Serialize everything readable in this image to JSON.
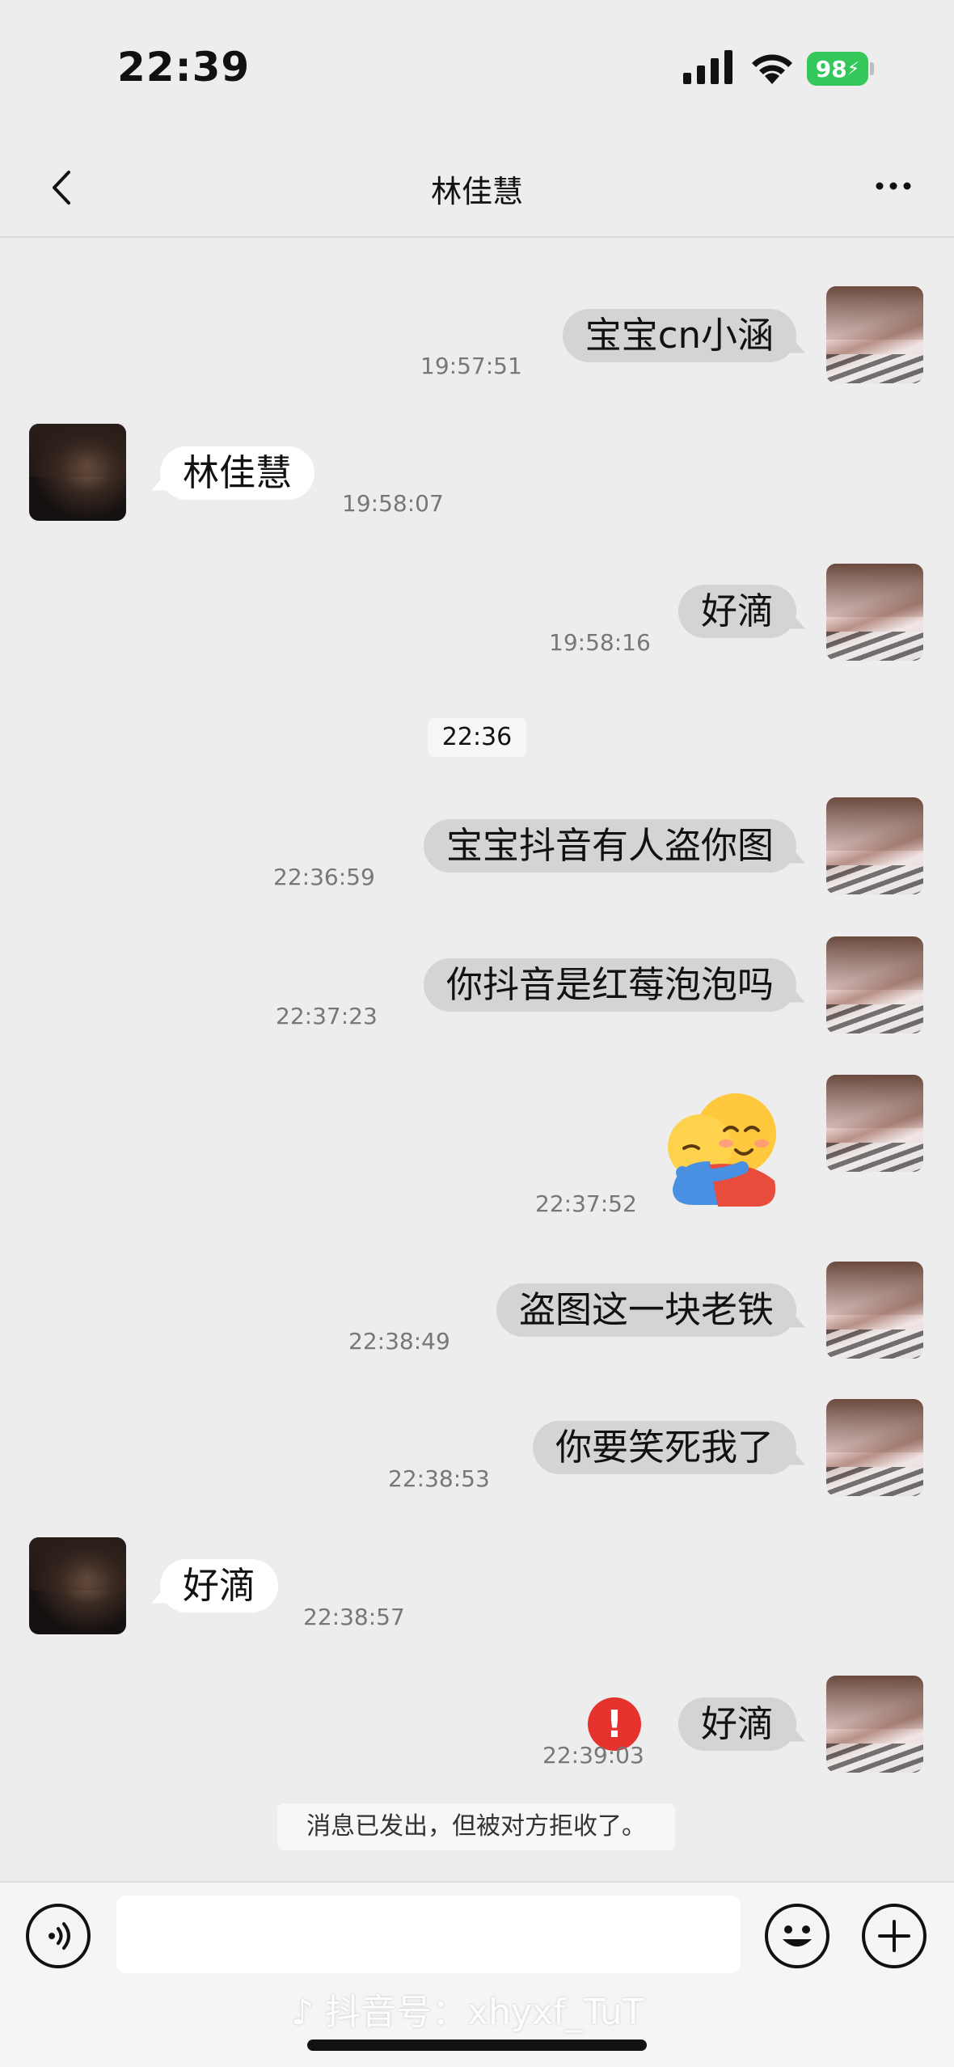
{
  "status_bar": {
    "time": "22:39",
    "battery": "98"
  },
  "nav": {
    "title": "林佳慧"
  },
  "messages": [
    {
      "side": "mine",
      "text": "宝宝cn小涵",
      "time": "19:57:51"
    },
    {
      "side": "theirs",
      "text": "林佳慧",
      "time": "19:58:07"
    },
    {
      "side": "mine",
      "text": "好滴",
      "time": "19:58:16"
    },
    {
      "side": "mine",
      "text": "宝宝抖音有人盗你图",
      "time": "22:36:59"
    },
    {
      "side": "mine",
      "text": "你抖音是红莓泡泡吗",
      "time": "22:37:23"
    },
    {
      "side": "mine",
      "sticker": "hugging-face",
      "time": "22:37:52"
    },
    {
      "side": "mine",
      "text": "盗图这一块老铁",
      "time": "22:38:49"
    },
    {
      "side": "mine",
      "text": "你要笑死我了",
      "time": "22:38:53"
    },
    {
      "side": "theirs",
      "text": "好滴",
      "time": "22:38:57"
    },
    {
      "side": "mine",
      "text": "好滴",
      "time": "22:39:03",
      "status": "rejected"
    }
  ],
  "center_time": "22:36",
  "error_icon": "!",
  "notice": "消息已发出，但被对方拒收了。",
  "input": {
    "placeholder": ""
  },
  "watermark": "抖音号：xhyxf_TuT",
  "icons": {
    "back": "chevron-left-icon",
    "more": "more-dots-icon",
    "voice": "voice-icon",
    "emoji": "emoji-icon",
    "plus": "plus-icon"
  },
  "colors": {
    "background": "#ededed",
    "my_bubble": "#d4d4d4",
    "their_bubble": "#ffffff",
    "error": "#e5322d",
    "battery": "#34c759"
  }
}
